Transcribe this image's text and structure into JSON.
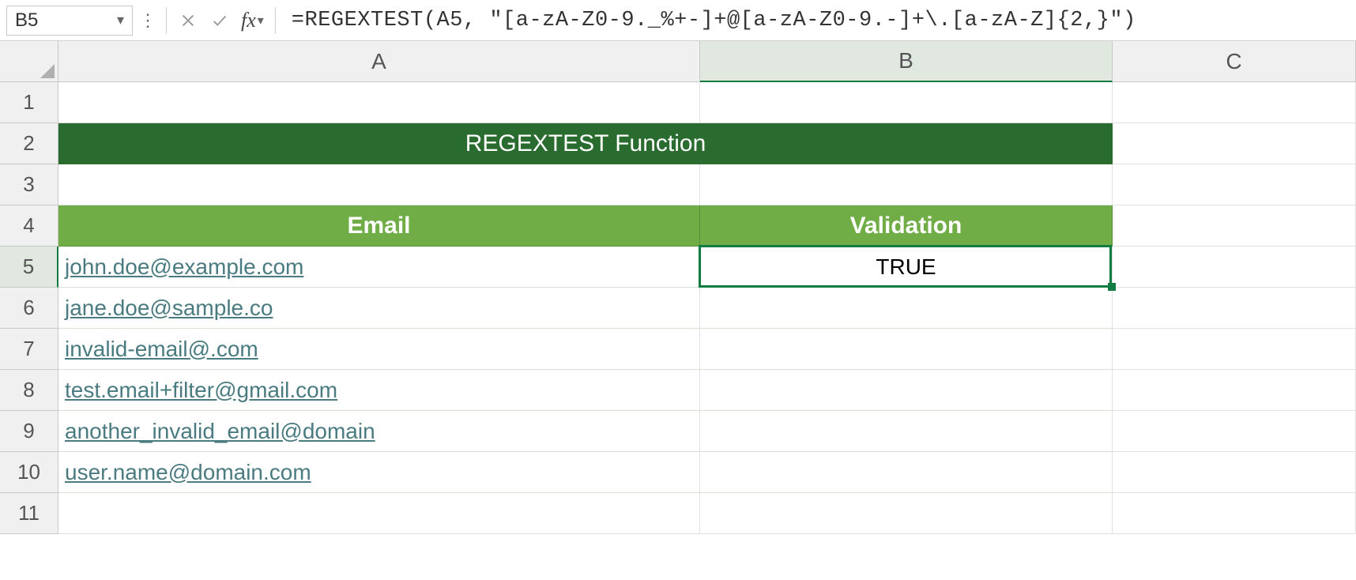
{
  "name_box": "B5",
  "formula": "=REGEXTEST(A5, \"[a-zA-Z0-9._%+-]+@[a-zA-Z0-9.-]+\\.[a-zA-Z]{2,}\")",
  "columns": [
    "A",
    "B",
    "C"
  ],
  "rows": [
    "1",
    "2",
    "3",
    "4",
    "5",
    "6",
    "7",
    "8",
    "9",
    "10",
    "11"
  ],
  "selected_col_index": 1,
  "selected_row_index": 4,
  "title": "REGEXTEST Function",
  "headers": {
    "email": "Email",
    "validation": "Validation"
  },
  "emails": [
    "john.doe@example.com",
    "jane.doe@sample.co",
    "invalid-email@.com",
    "test.email+filter@gmail.com",
    "another_invalid_email@domain",
    "user.name@domain.com"
  ],
  "validations": [
    "TRUE",
    "",
    "",
    "",
    "",
    ""
  ],
  "colors": {
    "title_bg": "#2a6b2f",
    "header_bg": "#70ad47",
    "selection": "#107c41",
    "link": "#4a7b80"
  },
  "chart_data": {
    "type": "table",
    "title": "REGEXTEST Function",
    "columns": [
      "Email",
      "Validation"
    ],
    "rows": [
      [
        "john.doe@example.com",
        "TRUE"
      ],
      [
        "jane.doe@sample.co",
        ""
      ],
      [
        "invalid-email@.com",
        ""
      ],
      [
        "test.email+filter@gmail.com",
        ""
      ],
      [
        "another_invalid_email@domain",
        ""
      ],
      [
        "user.name@domain.com",
        ""
      ]
    ]
  }
}
